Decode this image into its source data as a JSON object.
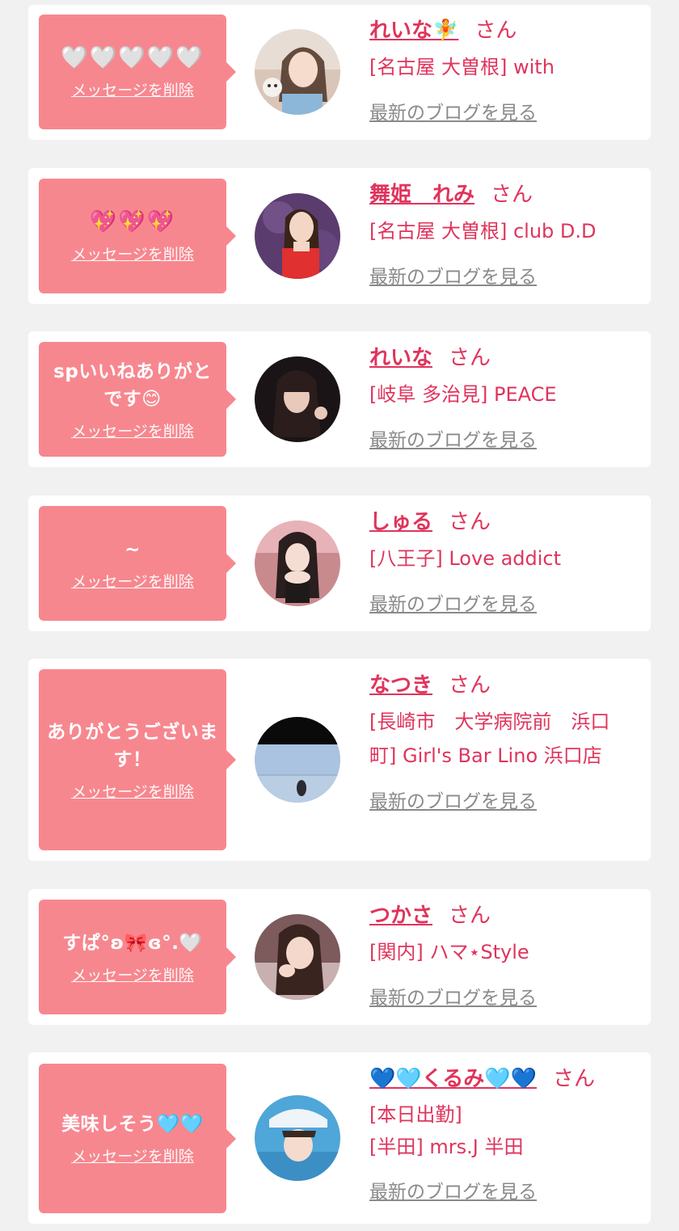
{
  "delete_label": "メッセージを削除",
  "san_label": "さん",
  "blog_label": "最新のブログを見る",
  "colors": {
    "background": "#f1f1f1",
    "card": "#ffffff",
    "bubble": "#f7878f",
    "accent": "#e0345c",
    "link_gray": "#8a8a8a"
  },
  "messages": [
    {
      "message": "🤍🤍🤍🤍🤍",
      "name": "れいな🧚",
      "shop": "[名古屋 大曽根] with",
      "shop2": ""
    },
    {
      "message": "💖💖💖",
      "name": "舞姫　れみ",
      "shop": "[名古屋 大曽根] club D.D",
      "shop2": ""
    },
    {
      "message": "spいいねありがとです😊",
      "name": "れいな",
      "shop": "[岐阜 多治見] PEACE",
      "shop2": ""
    },
    {
      "message": "~",
      "name": "しゅる",
      "shop": "[八王子] Love addict",
      "shop2": ""
    },
    {
      "message": "ありがとうございます！",
      "name": "なつき",
      "shop": "[長崎市　大学病院前　浜口町] Girl's Bar Lino 浜口店",
      "shop2": ""
    },
    {
      "message": "すぱ°ʚ🎀ɞ°.🤍",
      "name": "つかさ",
      "shop": "[関内] ハマ⋆Style",
      "shop2": ""
    },
    {
      "message": "美味しそう🩵🩵",
      "name": "💙🩵くるみ🩵💙",
      "shop": "[本日出勤]",
      "shop2": "[半田] mrs.J 半田"
    }
  ]
}
